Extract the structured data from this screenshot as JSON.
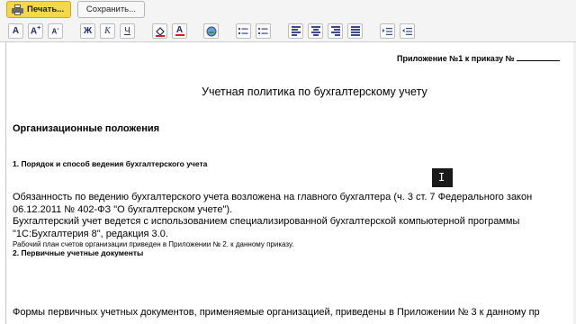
{
  "toolbar": {
    "print_label": "Печать...",
    "save_label": "Сохранить..."
  },
  "format_toolbar": {
    "font_bigger": "A",
    "font_bigger_sup": "+",
    "font_smaller": "A",
    "font_smaller_sup": "-",
    "bold": "Ж",
    "italic": "К",
    "underline": "Ч",
    "text_color": "A"
  },
  "document": {
    "appendix": "Приложение №1 к приказу №",
    "title": "Учетная политика по бухгалтерскому учету",
    "section": "Организационные положения",
    "heading1": "1. Порядок и способ ведения бухгалтерского учета",
    "para1_line1": "Обязанность по ведению бухгалтерского учета возложена на главного бухгалтера (ч. 3 ст. 7 Федерального закон",
    "para1_line2": "06.12.2011 № 402-ФЗ \"О бухгалтерском учете\").",
    "para2_line1": "Бухгалтерский учет ведется с использованием специализированной бухгалтерской компьютерной программы",
    "para2_line2": "\"1С:Бухгалтерия 8\", редакция 3.0.",
    "para3": "Рабочий план счетов организации приведен в Приложении № 2. к данному приказу.",
    "heading2": "2. Первичные учетные документы",
    "para4": "Формы первичных учетных документов, применяемые организацией, приведены в Приложении № 3 к данному пр"
  },
  "colors": {
    "print_button": "#f3d84a",
    "toolbar_bg": "#f4f4f4",
    "icon_blue": "#1f2a68",
    "text_color_red": "#d21f1f"
  }
}
